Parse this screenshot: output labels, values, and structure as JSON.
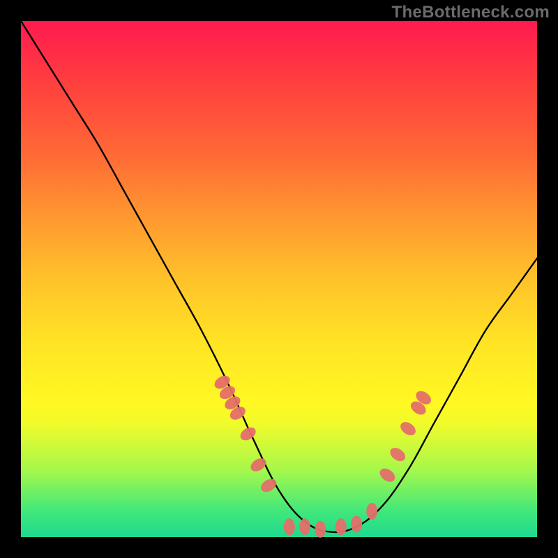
{
  "watermark": "TheBottleneck.com",
  "chart_data": {
    "type": "line",
    "title": "",
    "xlabel": "",
    "ylabel": "",
    "xlim": [
      0,
      100
    ],
    "ylim": [
      0,
      100
    ],
    "series": [
      {
        "name": "curve",
        "color": "#000000",
        "x": [
          0,
          5,
          10,
          15,
          20,
          25,
          30,
          35,
          40,
          45,
          50,
          55,
          60,
          65,
          70,
          75,
          80,
          85,
          90,
          95,
          100
        ],
        "y": [
          100,
          92,
          84,
          76,
          67,
          58,
          49,
          40,
          30,
          19,
          9,
          3,
          1,
          2,
          6,
          13,
          22,
          31,
          40,
          47,
          54
        ]
      },
      {
        "name": "marker-cluster-left",
        "color": "#e46f6a",
        "type": "scatter",
        "x": [
          39,
          40,
          41,
          42,
          44,
          46,
          48
        ],
        "y": [
          30,
          28,
          26,
          24,
          20,
          14,
          10
        ]
      },
      {
        "name": "marker-cluster-bottom",
        "color": "#e46f6a",
        "type": "scatter",
        "x": [
          52,
          55,
          58,
          62,
          65,
          68
        ],
        "y": [
          2,
          2,
          1.5,
          2,
          2.5,
          5
        ]
      },
      {
        "name": "marker-cluster-right",
        "color": "#e46f6a",
        "type": "scatter",
        "x": [
          71,
          73,
          75,
          77,
          78
        ],
        "y": [
          12,
          16,
          21,
          25,
          27
        ]
      }
    ],
    "background_gradient": {
      "stops": [
        {
          "pos": 0.0,
          "color": "#ff1a4f"
        },
        {
          "pos": 0.12,
          "color": "#ff3f3f"
        },
        {
          "pos": 0.26,
          "color": "#ff6a36"
        },
        {
          "pos": 0.38,
          "color": "#ff9830"
        },
        {
          "pos": 0.5,
          "color": "#ffc22a"
        },
        {
          "pos": 0.62,
          "color": "#ffe324"
        },
        {
          "pos": 0.74,
          "color": "#fff823"
        },
        {
          "pos": 0.78,
          "color": "#f1fb2a"
        },
        {
          "pos": 0.87,
          "color": "#a6f84a"
        },
        {
          "pos": 0.95,
          "color": "#40e87a"
        },
        {
          "pos": 1.0,
          "color": "#1ed98e"
        }
      ]
    }
  }
}
